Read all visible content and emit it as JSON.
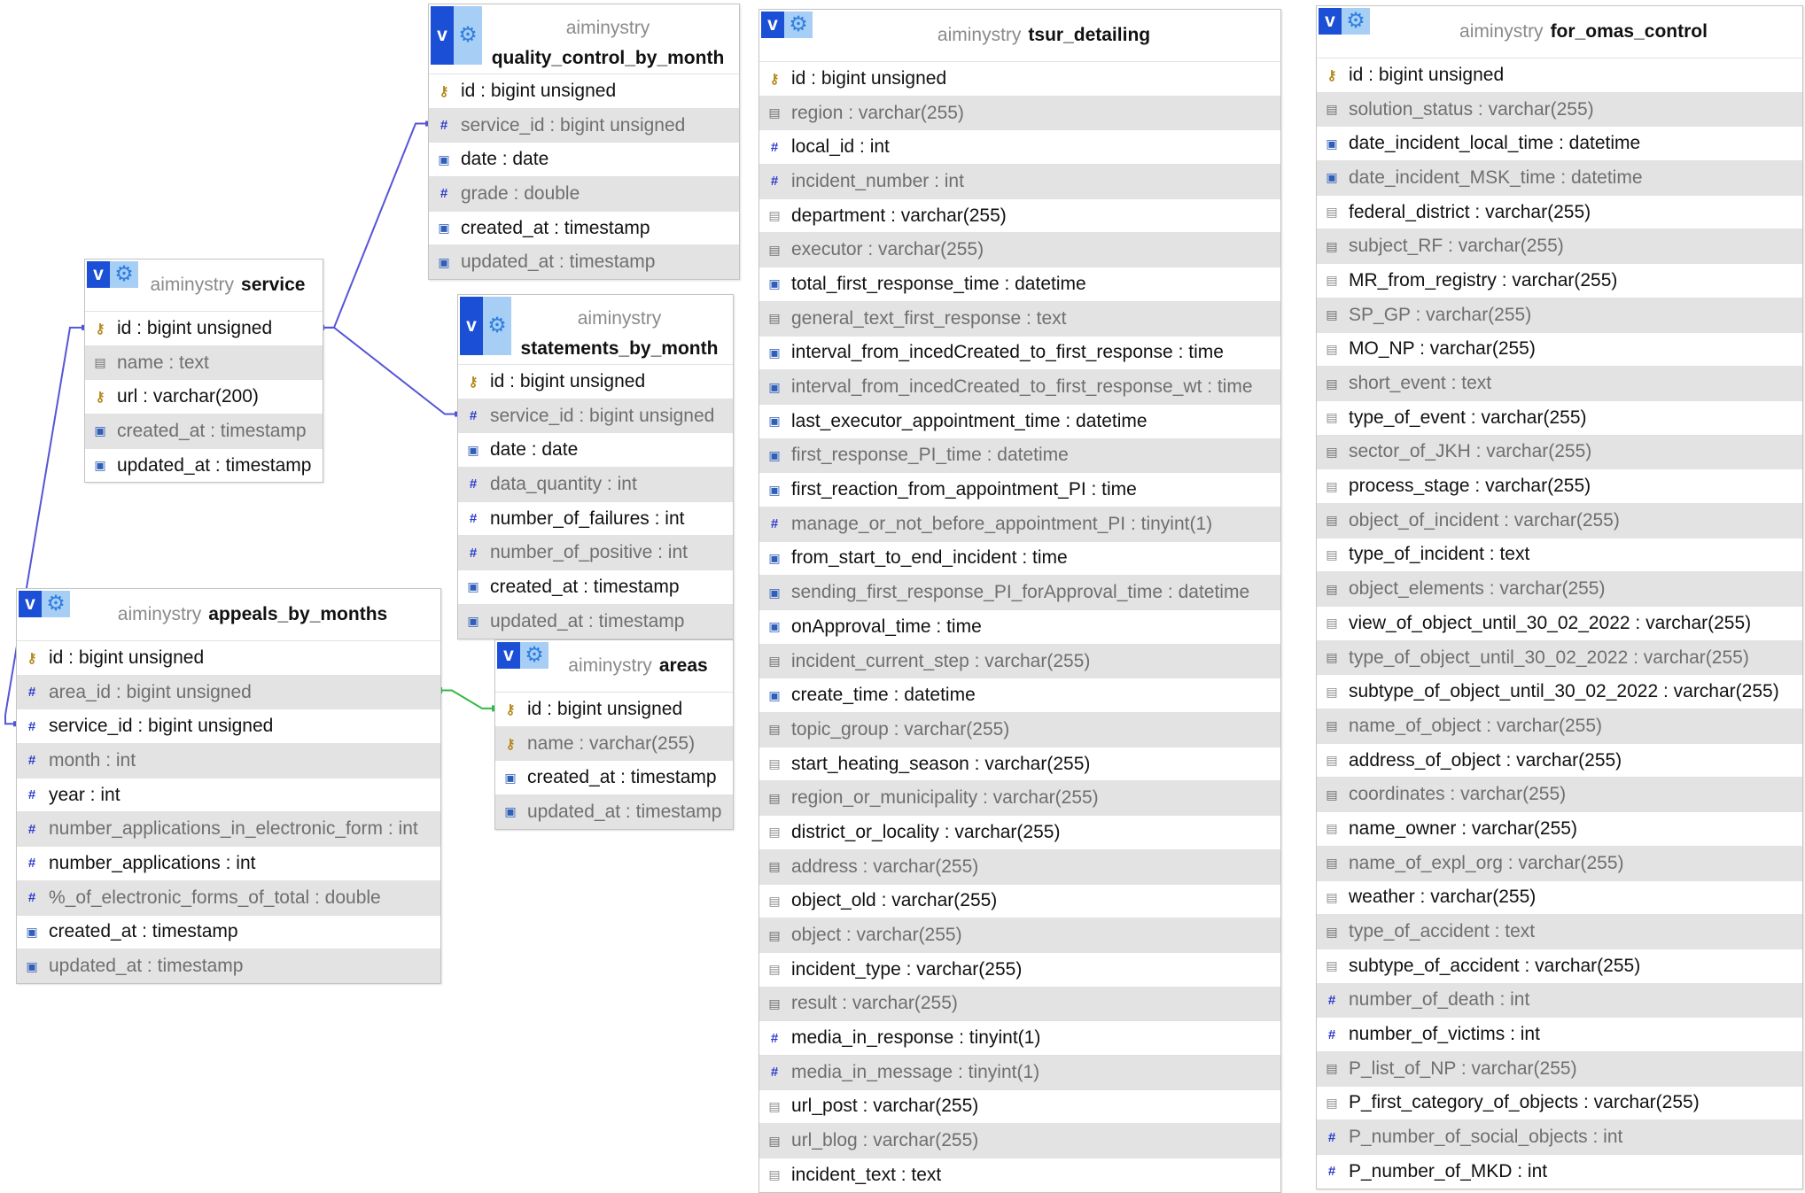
{
  "tables": [
    {
      "id": "quality_control_by_month",
      "db": "aiminystry",
      "name": "quality_control_by_month",
      "header_tall": true,
      "columns": [
        {
          "label": "id : bigint unsigned",
          "icon": "key-icon"
        },
        {
          "label": "service_id : bigint unsigned",
          "icon": "number-icon"
        },
        {
          "label": "date : date",
          "icon": "date-icon"
        },
        {
          "label": "grade : double",
          "icon": "number-icon"
        },
        {
          "label": "created_at : timestamp",
          "icon": "date-icon"
        },
        {
          "label": "updated_at : timestamp",
          "icon": "date-icon"
        }
      ]
    },
    {
      "id": "service",
      "db": "aiminystry",
      "name": "service",
      "header_tall": false,
      "columns": [
        {
          "label": "id : bigint unsigned",
          "icon": "key-icon"
        },
        {
          "label": "name : text",
          "icon": "text-icon"
        },
        {
          "label": "url : varchar(200)",
          "icon": "key-icon"
        },
        {
          "label": "created_at : timestamp",
          "icon": "date-icon"
        },
        {
          "label": "updated_at : timestamp",
          "icon": "date-icon"
        }
      ]
    },
    {
      "id": "statements_by_month",
      "db": "aiminystry",
      "name": "statements_by_month",
      "header_tall": true,
      "columns": [
        {
          "label": "id : bigint unsigned",
          "icon": "key-icon"
        },
        {
          "label": "service_id : bigint unsigned",
          "icon": "number-icon"
        },
        {
          "label": "date : date",
          "icon": "date-icon"
        },
        {
          "label": "data_quantity : int",
          "icon": "number-icon"
        },
        {
          "label": "number_of_failures : int",
          "icon": "number-icon"
        },
        {
          "label": "number_of_positive : int",
          "icon": "number-icon"
        },
        {
          "label": "created_at : timestamp",
          "icon": "date-icon"
        },
        {
          "label": "updated_at : timestamp",
          "icon": "date-icon"
        }
      ]
    },
    {
      "id": "appeals_by_months",
      "db": "aiminystry",
      "name": "appeals_by_months",
      "header_tall": false,
      "columns": [
        {
          "label": "id : bigint unsigned",
          "icon": "key-icon"
        },
        {
          "label": "area_id : bigint unsigned",
          "icon": "number-icon"
        },
        {
          "label": "service_id : bigint unsigned",
          "icon": "number-icon"
        },
        {
          "label": "month : int",
          "icon": "number-icon"
        },
        {
          "label": "year : int",
          "icon": "number-icon"
        },
        {
          "label": "number_applications_in_electronic_form : int",
          "icon": "number-icon"
        },
        {
          "label": "number_applications : int",
          "icon": "number-icon"
        },
        {
          "label": "%_of_electronic_forms_of_total : double",
          "icon": "number-icon"
        },
        {
          "label": "created_at : timestamp",
          "icon": "date-icon"
        },
        {
          "label": "updated_at : timestamp",
          "icon": "date-icon"
        }
      ]
    },
    {
      "id": "areas",
      "db": "aiminystry",
      "name": "areas",
      "header_tall": false,
      "columns": [
        {
          "label": "id : bigint unsigned",
          "icon": "key-icon"
        },
        {
          "label": "name : varchar(255)",
          "icon": "key-icon"
        },
        {
          "label": "created_at : timestamp",
          "icon": "date-icon"
        },
        {
          "label": "updated_at : timestamp",
          "icon": "date-icon"
        }
      ]
    },
    {
      "id": "tsur_detailing",
      "db": "aiminystry",
      "name": "tsur_detailing",
      "header_tall": false,
      "columns": [
        {
          "label": "id : bigint unsigned",
          "icon": "key-icon"
        },
        {
          "label": "region : varchar(255)",
          "icon": "text-icon"
        },
        {
          "label": "local_id : int",
          "icon": "number-icon"
        },
        {
          "label": "incident_number : int",
          "icon": "number-icon"
        },
        {
          "label": "department : varchar(255)",
          "icon": "text-icon"
        },
        {
          "label": "executor : varchar(255)",
          "icon": "text-icon"
        },
        {
          "label": "total_first_response_time : datetime",
          "icon": "date-icon"
        },
        {
          "label": "general_text_first_response : text",
          "icon": "text-icon"
        },
        {
          "label": "interval_from_incedCreated_to_first_response : time",
          "icon": "date-icon"
        },
        {
          "label": "interval_from_incedCreated_to_first_response_wt : time",
          "icon": "date-icon"
        },
        {
          "label": "last_executor_appointment_time : datetime",
          "icon": "date-icon"
        },
        {
          "label": "first_response_PI_time : datetime",
          "icon": "date-icon"
        },
        {
          "label": "first_reaction_from_appointment_PI : time",
          "icon": "date-icon"
        },
        {
          "label": "manage_or_not_before_appointment_PI : tinyint(1)",
          "icon": "number-icon"
        },
        {
          "label": "from_start_to_end_incident : time",
          "icon": "date-icon"
        },
        {
          "label": "sending_first_response_PI_forApproval_time : datetime",
          "icon": "date-icon"
        },
        {
          "label": "onApproval_time : time",
          "icon": "date-icon"
        },
        {
          "label": "incident_current_step : varchar(255)",
          "icon": "text-icon"
        },
        {
          "label": "create_time : datetime",
          "icon": "date-icon"
        },
        {
          "label": "topic_group : varchar(255)",
          "icon": "text-icon"
        },
        {
          "label": "start_heating_season : varchar(255)",
          "icon": "text-icon"
        },
        {
          "label": "region_or_municipality : varchar(255)",
          "icon": "text-icon"
        },
        {
          "label": "district_or_locality : varchar(255)",
          "icon": "text-icon"
        },
        {
          "label": "address : varchar(255)",
          "icon": "text-icon"
        },
        {
          "label": "object_old : varchar(255)",
          "icon": "text-icon"
        },
        {
          "label": "object : varchar(255)",
          "icon": "text-icon"
        },
        {
          "label": "incident_type : varchar(255)",
          "icon": "text-icon"
        },
        {
          "label": "result : varchar(255)",
          "icon": "text-icon"
        },
        {
          "label": "media_in_response : tinyint(1)",
          "icon": "number-icon"
        },
        {
          "label": "media_in_message : tinyint(1)",
          "icon": "number-icon"
        },
        {
          "label": "url_post : varchar(255)",
          "icon": "text-icon"
        },
        {
          "label": "url_blog : varchar(255)",
          "icon": "text-icon"
        },
        {
          "label": "incident_text : text",
          "icon": "text-icon"
        }
      ]
    },
    {
      "id": "for_omas_control",
      "db": "aiminystry",
      "name": "for_omas_control",
      "header_tall": false,
      "columns": [
        {
          "label": "id : bigint unsigned",
          "icon": "key-icon"
        },
        {
          "label": "solution_status : varchar(255)",
          "icon": "text-icon"
        },
        {
          "label": "date_incident_local_time : datetime",
          "icon": "date-icon"
        },
        {
          "label": "date_incident_MSK_time : datetime",
          "icon": "date-icon"
        },
        {
          "label": "federal_district : varchar(255)",
          "icon": "text-icon"
        },
        {
          "label": "subject_RF : varchar(255)",
          "icon": "text-icon"
        },
        {
          "label": "MR_from_registry : varchar(255)",
          "icon": "text-icon"
        },
        {
          "label": "SP_GP : varchar(255)",
          "icon": "text-icon"
        },
        {
          "label": "MO_NP : varchar(255)",
          "icon": "text-icon"
        },
        {
          "label": "short_event : text",
          "icon": "text-icon"
        },
        {
          "label": "type_of_event : varchar(255)",
          "icon": "text-icon"
        },
        {
          "label": "sector_of_JKH : varchar(255)",
          "icon": "text-icon"
        },
        {
          "label": "process_stage : varchar(255)",
          "icon": "text-icon"
        },
        {
          "label": "object_of_incident : varchar(255)",
          "icon": "text-icon"
        },
        {
          "label": "type_of_incident : text",
          "icon": "text-icon"
        },
        {
          "label": "object_elements : varchar(255)",
          "icon": "text-icon"
        },
        {
          "label": "view_of_object_until_30_02_2022 : varchar(255)",
          "icon": "text-icon"
        },
        {
          "label": "type_of_object_until_30_02_2022 : varchar(255)",
          "icon": "text-icon"
        },
        {
          "label": "subtype_of_object_until_30_02_2022 : varchar(255)",
          "icon": "text-icon"
        },
        {
          "label": "name_of_object : varchar(255)",
          "icon": "text-icon"
        },
        {
          "label": "address_of_object : varchar(255)",
          "icon": "text-icon"
        },
        {
          "label": "coordinates : varchar(255)",
          "icon": "text-icon"
        },
        {
          "label": "name_owner : varchar(255)",
          "icon": "text-icon"
        },
        {
          "label": "name_of_expl_org : varchar(255)",
          "icon": "text-icon"
        },
        {
          "label": "weather : varchar(255)",
          "icon": "text-icon"
        },
        {
          "label": "type_of_accident : text",
          "icon": "text-icon"
        },
        {
          "label": "subtype_of_accident : varchar(255)",
          "icon": "text-icon"
        },
        {
          "label": "number_of_death : int",
          "icon": "number-icon"
        },
        {
          "label": "number_of_victims : int",
          "icon": "number-icon"
        },
        {
          "label": "P_list_of_NP : varchar(255)",
          "icon": "text-icon"
        },
        {
          "label": "P_first_category_of_objects : varchar(255)",
          "icon": "text-icon"
        },
        {
          "label": "P_number_of_social_objects : int",
          "icon": "number-icon"
        },
        {
          "label": "P_number_of_MKD : int",
          "icon": "number-icon"
        }
      ]
    }
  ],
  "relations": [
    {
      "from": "service.id",
      "to": "quality_control_by_month.service_id",
      "color": "#5555d8"
    },
    {
      "from": "service.id",
      "to": "statements_by_month.service_id",
      "color": "#5555d8"
    },
    {
      "from": "service.id",
      "to": "appeals_by_months.service_id",
      "color": "#5555d8"
    },
    {
      "from": "areas.id",
      "to": "appeals_by_months.area_id",
      "color": "#33bb44"
    }
  ]
}
